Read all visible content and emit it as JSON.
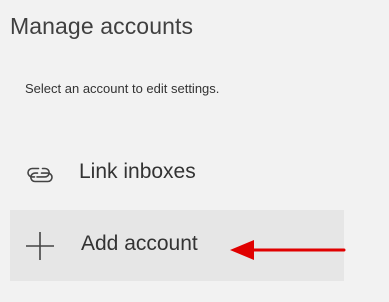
{
  "page": {
    "title": "Manage accounts",
    "subtitle": "Select an account to edit settings."
  },
  "menu": {
    "items": [
      {
        "label": "Link inboxes",
        "icon": "link-icon"
      },
      {
        "label": "Add account",
        "icon": "plus-icon"
      }
    ]
  },
  "annotation": {
    "icon": "red-arrow-icon",
    "color": "#e00000"
  },
  "colors": {
    "background": "#f2f2f2",
    "selected_item_background": "#e6e6e6",
    "text": "#333333"
  }
}
